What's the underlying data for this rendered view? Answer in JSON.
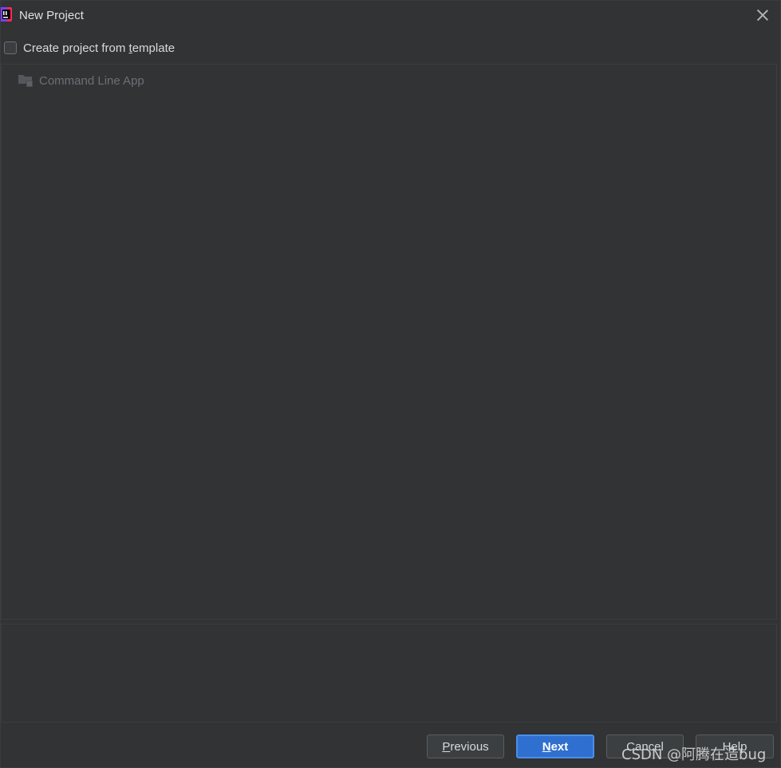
{
  "window": {
    "title": "New Project",
    "close_icon": "close-icon",
    "app_icon": "intellij-idea-icon"
  },
  "template_option": {
    "checkbox_label": "Create project from template",
    "checked": false
  },
  "templates": {
    "items": [
      {
        "label": "Command Line App",
        "icon": "folder-icon",
        "enabled": false
      }
    ]
  },
  "buttons": {
    "previous": {
      "pre": "",
      "u": "P",
      "post": "revious"
    },
    "next": {
      "pre": "",
      "u": "N",
      "post": "ext"
    },
    "cancel": "Cancel",
    "help": "Help"
  },
  "watermark": "CSDN @阿腾在造bug",
  "colors": {
    "background": "#313335",
    "primary_button": "#2f6fcf",
    "disabled_text": "#6c7075"
  }
}
